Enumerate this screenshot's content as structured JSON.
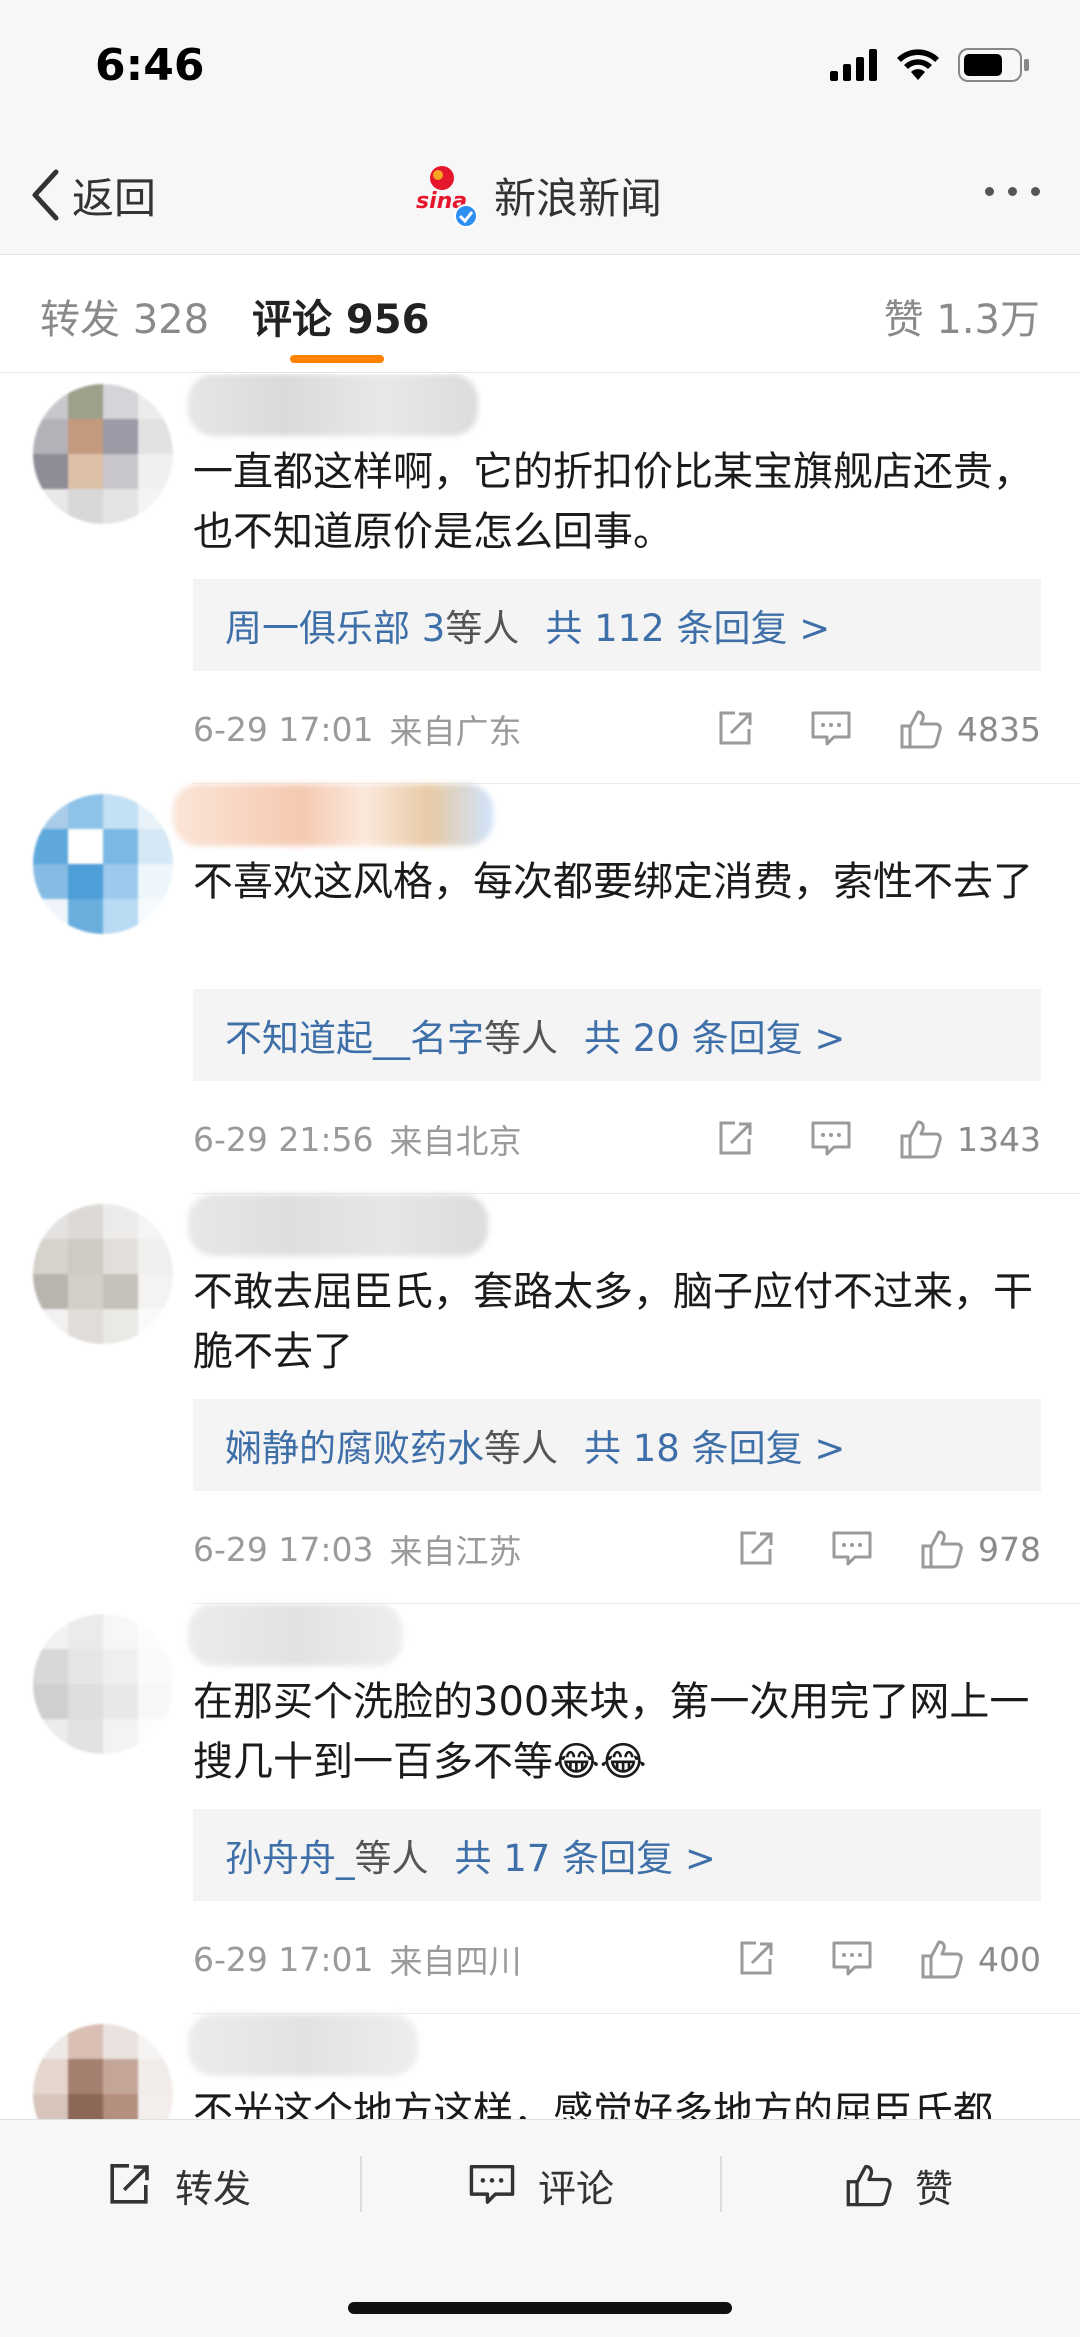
{
  "status_bar": {
    "time": "6:46"
  },
  "nav": {
    "back_label": "返回",
    "title": "新浪新闻",
    "logo_text": "sina"
  },
  "tabs": {
    "forward": "转发 328",
    "comment": "评论 956",
    "like": "赞 1.3万"
  },
  "comments": [
    {
      "text": "一直都这样啊，它的折扣价比某宝旗舰店还贵，也不知道原价是怎么回事。",
      "reply_names": "周一俱乐部 3",
      "reply_suffix": "等人",
      "reply_count": "共 112 条回复 >",
      "date": "6-29 17:01",
      "location": "来自广东",
      "likes": "4835"
    },
    {
      "text": "不喜欢这风格，每次都要绑定消费，索性不去了",
      "reply_names": "不知道起__名字",
      "reply_suffix": "等人",
      "reply_count": "共 20 条回复 >",
      "date": "6-29 21:56",
      "location": "来自北京",
      "likes": "1343"
    },
    {
      "text": "不敢去屈臣氏，套路太多，脑子应付不过来，干脆不去了",
      "reply_names": "娴静的腐败药水",
      "reply_suffix": "等人",
      "reply_count": "共 18 条回复 >",
      "date": "6-29 17:03",
      "location": "来自江苏",
      "likes": "978"
    },
    {
      "text": "在那买个洗脸的300来块，第一次用完了网上一搜几十到一百多不等😂😂",
      "reply_names": "孙舟舟_",
      "reply_suffix": "等人",
      "reply_count": "共 17 条回复 >",
      "date": "6-29 17:01",
      "location": "来自四川",
      "likes": "400"
    },
    {
      "text": "不光这个地方这样，感觉好多地方的屈臣氏都"
    }
  ],
  "bottom_bar": {
    "forward": "转发",
    "comment": "评论",
    "like": "赞"
  },
  "colors": {
    "accent": "#ff8200",
    "link": "#3e6fa8",
    "meta": "#9a9a9a"
  }
}
